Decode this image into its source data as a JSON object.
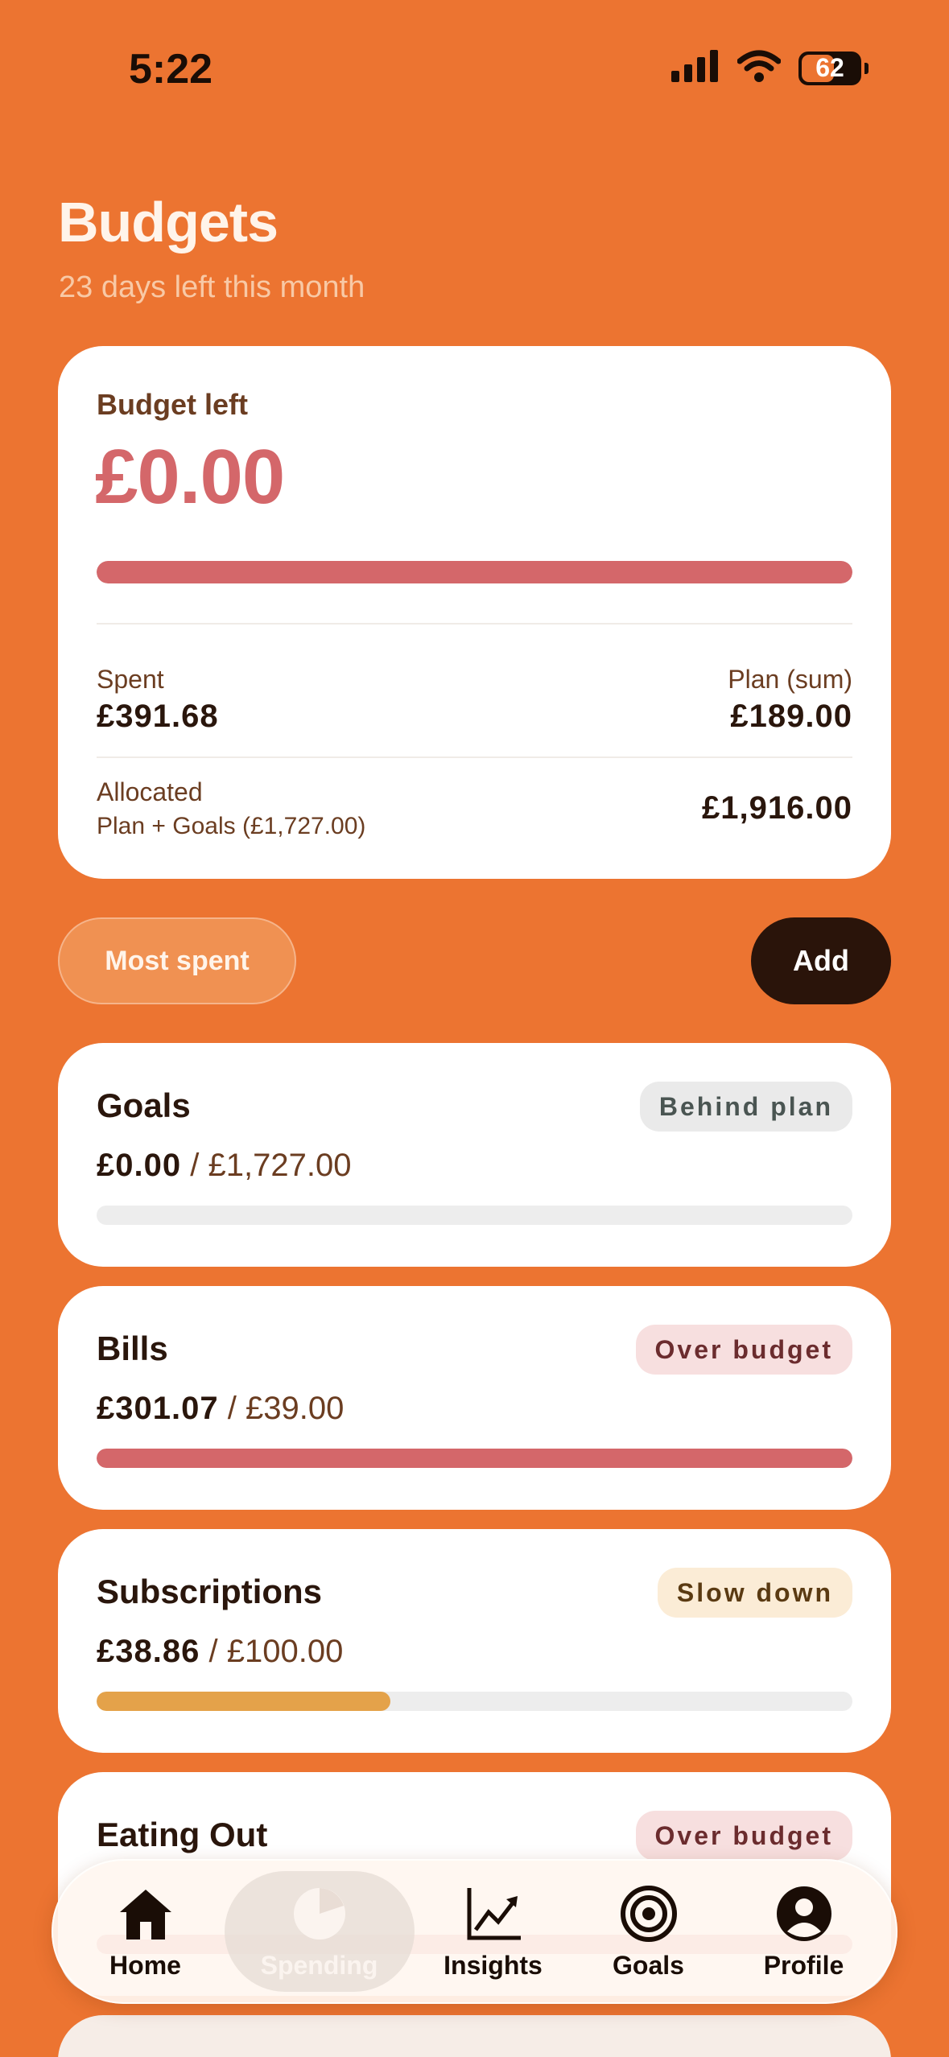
{
  "status_bar": {
    "time": "5:22",
    "battery": "62"
  },
  "header": {
    "title": "Budgets",
    "subtitle": "23 days left this month"
  },
  "summary": {
    "label": "Budget left",
    "amount": "£0.00",
    "progress": 1.0,
    "spent_label": "Spent",
    "spent_value": "£391.68",
    "plan_label": "Plan (sum)",
    "plan_value": "£189.00",
    "allocated_label": "Allocated",
    "allocated_note": "Plan + Goals (£1,727.00)",
    "allocated_value": "£1,916.00"
  },
  "controls": {
    "sort_label": "Most spent",
    "add_label": "Add"
  },
  "categories": [
    {
      "name": "Goals",
      "badge": "Behind plan",
      "spent": "£0.00",
      "separator": "/",
      "plan": "£1,727.00",
      "progress": 0.0,
      "badge_bg": "#eaeaea",
      "badge_fg": "#4a5552",
      "bar_color": "#d4676a"
    },
    {
      "name": "Bills",
      "badge": "Over budget",
      "spent": "£301.07",
      "separator": "/",
      "plan": "£39.00",
      "progress": 1.0,
      "badge_bg": "#f7dfdf",
      "badge_fg": "#6b2c2e",
      "bar_color": "#d4676a"
    },
    {
      "name": "Subscriptions",
      "badge": "Slow down",
      "spent": "£38.86",
      "separator": "/",
      "plan": "£100.00",
      "progress": 0.3886,
      "badge_bg": "#fbecd6",
      "badge_fg": "#5a3a12",
      "bar_color": "#e4a24a"
    },
    {
      "name": "Eating Out",
      "badge": "Over budget",
      "spent": "",
      "separator": "",
      "plan": "",
      "progress": 1.0,
      "badge_bg": "#f7dfdf",
      "badge_fg": "#6b2c2e",
      "bar_color": "#d4676a"
    }
  ],
  "tab_bar": [
    {
      "label": "Home",
      "icon": "home-icon"
    },
    {
      "label": "Spending",
      "icon": "pie-chart-icon"
    },
    {
      "label": "Insights",
      "icon": "trend-chart-icon"
    },
    {
      "label": "Goals",
      "icon": "target-icon"
    },
    {
      "label": "Profile",
      "icon": "person-icon"
    }
  ],
  "colors": {
    "background": "#EC7431",
    "alert": "#d4676a",
    "warning": "#e4a24a",
    "dark": "#2a140a"
  }
}
